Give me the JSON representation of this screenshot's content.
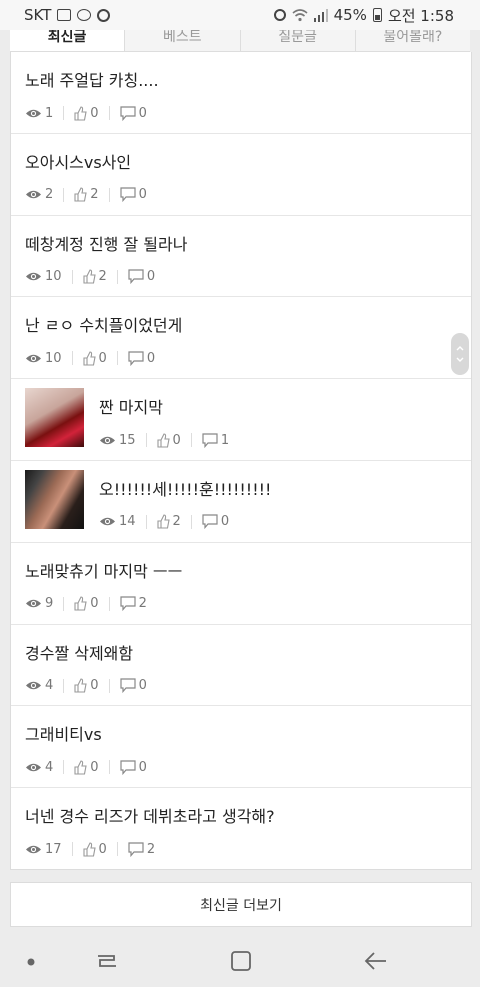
{
  "status_bar": {
    "carrier": "SKT",
    "battery": "45%",
    "time": "오전 1:58"
  },
  "tabs": [
    {
      "label": "최신글",
      "active": true
    },
    {
      "label": "베스트",
      "active": false
    },
    {
      "label": "질문글",
      "active": false
    },
    {
      "label": "물어볼래?",
      "active": false
    }
  ],
  "posts": [
    {
      "title": "노래 주얼답 카칭....",
      "views": "1",
      "likes": "0",
      "comments": "0",
      "thumbnail": null
    },
    {
      "title": "오아시스vs사인",
      "views": "2",
      "likes": "2",
      "comments": "0",
      "thumbnail": null
    },
    {
      "title": "떼창계정 진행 잘 될라나",
      "views": "10",
      "likes": "2",
      "comments": "0",
      "thumbnail": null
    },
    {
      "title": "난 ㄹㅇ 수치플이었던게",
      "views": "10",
      "likes": "0",
      "comments": "0",
      "thumbnail": null
    },
    {
      "title": "짠 마지막",
      "views": "15",
      "likes": "0",
      "comments": "1",
      "thumbnail": "thumb1"
    },
    {
      "title": "오!!!!!!세!!!!!훈!!!!!!!!!",
      "views": "14",
      "likes": "2",
      "comments": "0",
      "thumbnail": "thumb2"
    },
    {
      "title": "노래맞츄기 마지막 ㅡㅡ",
      "views": "9",
      "likes": "0",
      "comments": "2",
      "thumbnail": null
    },
    {
      "title": "경수짤 삭제왜함",
      "views": "4",
      "likes": "0",
      "comments": "0",
      "thumbnail": null
    },
    {
      "title": "그래비티vs",
      "views": "4",
      "likes": "0",
      "comments": "0",
      "thumbnail": null
    },
    {
      "title": "너넨 경수 리즈가 데뷔초라고 생각해?",
      "views": "17",
      "likes": "0",
      "comments": "2",
      "thumbnail": null
    }
  ],
  "more_button": "최신글 더보기",
  "icons": {
    "views": "eye-icon",
    "likes": "thumbs-up-icon",
    "comments": "speech-bubble-icon"
  },
  "colors": {
    "background": "#ececec",
    "card": "#ffffff",
    "meta_text": "#777777",
    "title_text": "#222222"
  }
}
